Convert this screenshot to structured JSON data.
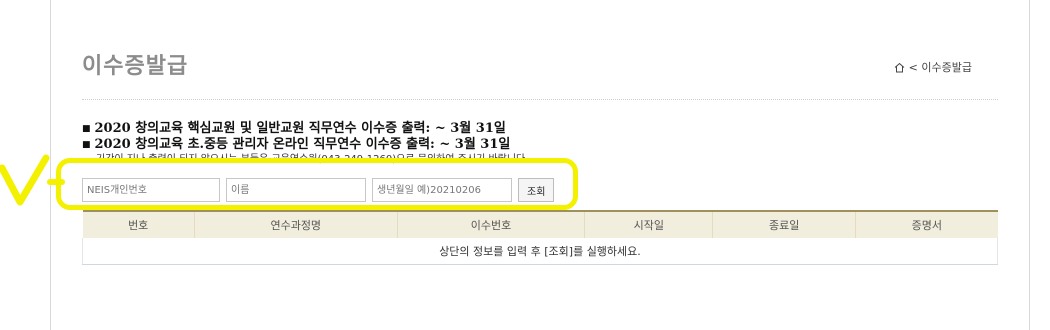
{
  "page": {
    "title": "이수증발급",
    "breadcrumb": "< 이수증발급"
  },
  "notices": [
    "2020 창의교육 핵심교원 및 일반교원 직무연수 이수증 출력: ~ 3월 31일",
    "2020 창의교육 초.중등 관리자 온라인 직무연수 이수증 출력: ~ 3월 31일"
  ],
  "note": "기간이 지나 출력이 되지 않으시는 분들은 교육연수원(043-249-1260)으로 문의하여 주시기 바랍니다.",
  "search": {
    "neis_placeholder": "NEIS개인번호",
    "name_placeholder": "이름",
    "birth_placeholder": "생년월일 예)20210206",
    "submit_label": "조회"
  },
  "table": {
    "columns": [
      "번호",
      "연수과정명",
      "이수번호",
      "시작일",
      "종료일",
      "증명서"
    ],
    "empty_message": "상단의 정보를 입력 후 [조회]를 실행하세요."
  },
  "annotation": {
    "color": "#f3f000"
  }
}
